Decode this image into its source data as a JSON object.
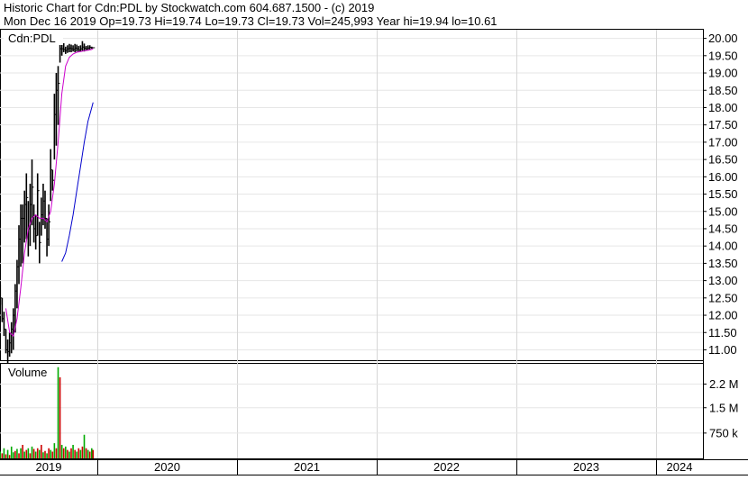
{
  "header": {
    "line1": "Historic Chart for Cdn:PDL by Stockwatch.com 604.687.1500 - (c) 2019",
    "line2": "Mon Dec 16 2019   Op=19.73   Hi=19.74   Lo=19.73   Cl=19.73   Vol=245,993   Year hi=19.94   lo=10.61"
  },
  "price_panel": {
    "label": "Cdn:PDL"
  },
  "volume_panel": {
    "label": "Volume"
  },
  "chart_data": [
    {
      "type": "line",
      "panel": "price",
      "title": "Cdn:PDL",
      "y_ticks": [
        "20.00",
        "19.50",
        "19.00",
        "18.50",
        "18.00",
        "17.50",
        "17.00",
        "16.50",
        "16.00",
        "15.50",
        "15.00",
        "14.50",
        "14.00",
        "13.50",
        "13.00",
        "12.50",
        "12.00",
        "11.50",
        "11.00"
      ],
      "ylim": [
        10.7,
        20.25
      ],
      "x_ticks": [
        "2019",
        "2020",
        "2021",
        "2022",
        "2023",
        "2024"
      ],
      "series": [
        {
          "style": "price-bars",
          "color": "#000000",
          "x": [
            "2019-01-02",
            "2019-01-09",
            "2019-01-16",
            "2019-01-23",
            "2019-01-30",
            "2019-02-06",
            "2019-02-13",
            "2019-02-20",
            "2019-02-27",
            "2019-03-06",
            "2019-03-13",
            "2019-03-20",
            "2019-03-27",
            "2019-04-03",
            "2019-04-10",
            "2019-04-17",
            "2019-04-24",
            "2019-05-01",
            "2019-05-08",
            "2019-05-15",
            "2019-05-22",
            "2019-05-29",
            "2019-06-05",
            "2019-06-12",
            "2019-06-19",
            "2019-06-26",
            "2019-07-03",
            "2019-07-10",
            "2019-07-17",
            "2019-07-24",
            "2019-07-31",
            "2019-08-07",
            "2019-08-14",
            "2019-08-21",
            "2019-08-28",
            "2019-09-04",
            "2019-09-11",
            "2019-09-18",
            "2019-09-25",
            "2019-10-02",
            "2019-10-09",
            "2019-10-16",
            "2019-10-23",
            "2019-10-30",
            "2019-11-06",
            "2019-11-13",
            "2019-11-20",
            "2019-11-27",
            "2019-12-04",
            "2019-12-11",
            "2019-12-16"
          ],
          "low": [
            12.3,
            11.8,
            11.4,
            10.9,
            10.61,
            10.8,
            10.9,
            11.0,
            11.5,
            12.2,
            12.9,
            13.4,
            13.5,
            14.1,
            14.2,
            13.7,
            14.0,
            14.6,
            14.1,
            13.9,
            14.3,
            13.5,
            14.3,
            14.6,
            14.5,
            13.7,
            14.0,
            15.3,
            15.6,
            16.5,
            16.9,
            17.5,
            19.3,
            19.5,
            19.6,
            19.55,
            19.58,
            19.6,
            19.6,
            19.62,
            19.6,
            19.62,
            19.6,
            19.62,
            19.64,
            19.62,
            19.64,
            19.65,
            19.68,
            19.7,
            19.73
          ],
          "high": [
            12.9,
            12.5,
            12.1,
            11.6,
            11.3,
            11.5,
            11.8,
            12.2,
            12.9,
            13.6,
            14.6,
            15.2,
            15.2,
            15.6,
            16.1,
            15.3,
            15.8,
            16.5,
            15.2,
            14.9,
            16.1,
            14.7,
            15.4,
            15.8,
            15.6,
            14.8,
            15.2,
            16.8,
            16.2,
            18.4,
            19.0,
            19.2,
            19.9,
            19.94,
            19.86,
            19.76,
            19.8,
            19.84,
            19.82,
            19.8,
            19.84,
            19.82,
            19.78,
            19.8,
            19.92,
            19.85,
            19.78,
            19.8,
            19.8,
            19.76,
            19.74
          ],
          "close": [
            12.5,
            11.9,
            11.6,
            11.0,
            10.95,
            11.2,
            11.6,
            12.0,
            12.7,
            13.4,
            14.2,
            14.8,
            14.8,
            15.2,
            15.4,
            14.5,
            15.2,
            15.7,
            14.5,
            14.3,
            15.6,
            14.1,
            14.9,
            15.3,
            14.8,
            14.2,
            14.7,
            16.2,
            15.9,
            17.8,
            18.5,
            18.7,
            19.7,
            19.7,
            19.68,
            19.65,
            19.7,
            19.72,
            19.7,
            19.68,
            19.72,
            19.7,
            19.66,
            19.7,
            19.75,
            19.72,
            19.7,
            19.72,
            19.74,
            19.73,
            19.73
          ]
        },
        {
          "style": "moving-average",
          "color": "#cc00cc",
          "x": [
            "2019-01-23",
            "2019-02-06",
            "2019-02-20",
            "2019-03-06",
            "2019-03-20",
            "2019-04-03",
            "2019-04-17",
            "2019-05-01",
            "2019-05-15",
            "2019-05-29",
            "2019-06-12",
            "2019-06-26",
            "2019-07-10",
            "2019-07-24",
            "2019-08-07",
            "2019-08-21",
            "2019-09-04",
            "2019-09-18",
            "2019-10-02",
            "2019-10-16",
            "2019-10-30",
            "2019-11-13",
            "2019-11-27",
            "2019-12-11",
            "2019-12-16"
          ],
          "values": [
            12.2,
            11.5,
            11.4,
            11.9,
            12.8,
            13.8,
            14.5,
            14.8,
            14.9,
            14.8,
            14.8,
            14.7,
            15.0,
            15.8,
            17.0,
            18.4,
            19.2,
            19.45,
            19.55,
            19.6,
            19.62,
            19.64,
            19.66,
            19.68,
            19.7
          ]
        },
        {
          "style": "moving-average",
          "color": "#0000cc",
          "x": [
            "2019-08-21",
            "2019-09-04",
            "2019-09-18",
            "2019-10-02",
            "2019-10-16",
            "2019-10-30",
            "2019-11-13",
            "2019-11-27",
            "2019-12-11",
            "2019-12-16"
          ],
          "values": [
            13.55,
            13.8,
            14.3,
            14.9,
            15.6,
            16.3,
            17.0,
            17.6,
            18.0,
            18.15
          ]
        }
      ]
    },
    {
      "type": "bar",
      "panel": "volume",
      "title": "Volume",
      "y_ticks": [
        "2.2 M",
        "1.5 M",
        "750 k"
      ],
      "ylim": [
        0,
        2.8
      ],
      "x": [
        "2019-01-02",
        "2019-01-09",
        "2019-01-16",
        "2019-01-23",
        "2019-01-30",
        "2019-02-06",
        "2019-02-13",
        "2019-02-20",
        "2019-02-27",
        "2019-03-06",
        "2019-03-13",
        "2019-03-20",
        "2019-03-27",
        "2019-04-03",
        "2019-04-10",
        "2019-04-17",
        "2019-04-24",
        "2019-05-01",
        "2019-05-08",
        "2019-05-15",
        "2019-05-22",
        "2019-05-29",
        "2019-06-05",
        "2019-06-12",
        "2019-06-19",
        "2019-06-26",
        "2019-07-03",
        "2019-07-10",
        "2019-07-17",
        "2019-07-24",
        "2019-07-31",
        "2019-08-07",
        "2019-08-14",
        "2019-08-21",
        "2019-08-28",
        "2019-09-04",
        "2019-09-11",
        "2019-09-18",
        "2019-09-25",
        "2019-10-02",
        "2019-10-09",
        "2019-10-16",
        "2019-10-23",
        "2019-10-30",
        "2019-11-06",
        "2019-11-13",
        "2019-11-20",
        "2019-11-27",
        "2019-12-04",
        "2019-12-11",
        "2019-12-16"
      ],
      "values": [
        0.2,
        0.15,
        0.3,
        0.12,
        0.25,
        0.1,
        0.35,
        0.18,
        0.22,
        0.28,
        0.15,
        0.3,
        0.4,
        0.2,
        0.25,
        0.3,
        0.15,
        0.35,
        0.28,
        0.2,
        0.3,
        0.25,
        0.4,
        0.18,
        0.22,
        0.15,
        0.3,
        0.25,
        0.2,
        0.45,
        0.3,
        2.7,
        2.4,
        0.4,
        0.3,
        0.35,
        0.25,
        0.2,
        0.3,
        0.4,
        0.25,
        0.2,
        0.3,
        0.25,
        0.35,
        0.7,
        0.3,
        0.25,
        0.2,
        0.3,
        0.25
      ],
      "colors": [
        "#00aa00",
        "#cc0000",
        "#00aa00",
        "#cc0000",
        "#00aa00",
        "#cc0000",
        "#00aa00",
        "#00aa00",
        "#cc0000",
        "#00aa00",
        "#cc0000",
        "#00aa00",
        "#cc0000",
        "#00aa00",
        "#cc0000",
        "#00aa00",
        "#cc0000",
        "#00aa00",
        "#cc0000",
        "#00aa00",
        "#cc0000",
        "#00aa00",
        "#cc0000",
        "#00aa00",
        "#cc0000",
        "#00aa00",
        "#cc0000",
        "#00aa00",
        "#cc0000",
        "#00aa00",
        "#cc0000",
        "#00aa00",
        "#cc0000",
        "#00aa00",
        "#cc0000",
        "#00aa00",
        "#cc0000",
        "#00aa00",
        "#cc0000",
        "#00aa00",
        "#cc0000",
        "#00aa00",
        "#cc0000",
        "#00aa00",
        "#cc0000",
        "#00aa00",
        "#cc0000",
        "#00aa00",
        "#cc0000",
        "#00aa00",
        "#cc0000"
      ]
    }
  ]
}
